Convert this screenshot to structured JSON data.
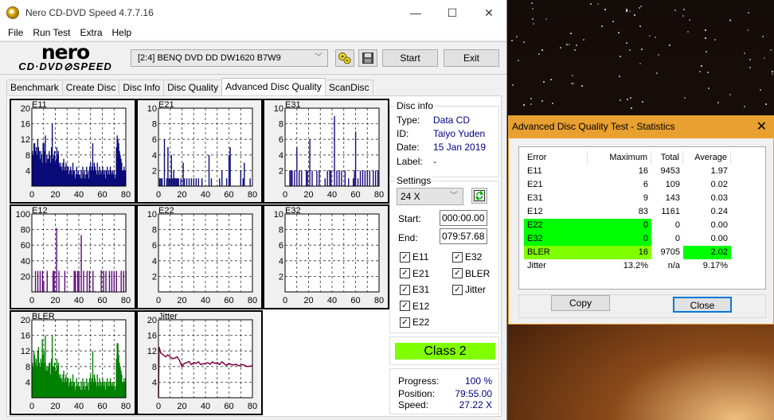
{
  "window": {
    "title": "Nero CD-DVD Speed 4.7.7.16",
    "minimize": "—",
    "maximize": "☐",
    "close": "✕"
  },
  "menu": [
    "File",
    "Run Test",
    "Extra",
    "Help"
  ],
  "logo": {
    "top": "nero",
    "bottom": "CD·DVD⊘SPEED"
  },
  "toolbar": {
    "drive": "[2:4]  BENQ DVD DD DW1620 B7W9",
    "start": "Start",
    "exit": "Exit"
  },
  "tabs": [
    "Benchmark",
    "Create Disc",
    "Disc Info",
    "Disc Quality",
    "Advanced Disc Quality",
    "ScanDisc"
  ],
  "active_tab": "Advanced Disc Quality",
  "disc_info": {
    "title": "Disc info",
    "type_label": "Type:",
    "type": "Data CD",
    "id_label": "ID:",
    "id": "Taiyo Yuden",
    "date_label": "Date:",
    "date": "15 Jan 2019",
    "label_label": "Label:",
    "label": "-"
  },
  "settings": {
    "title": "Settings",
    "speed": "24 X",
    "start_label": "Start:",
    "start": "000:00.00",
    "end_label": "End:",
    "end": "079:57.68",
    "checks": [
      {
        "label": "E11",
        "checked": true
      },
      {
        "label": "E21",
        "checked": true
      },
      {
        "label": "E31",
        "checked": true
      },
      {
        "label": "E12",
        "checked": true
      },
      {
        "label": "E22",
        "checked": true
      },
      {
        "label": "E32",
        "checked": true
      },
      {
        "label": "BLER",
        "checked": true
      },
      {
        "label": "Jitter",
        "checked": true
      }
    ]
  },
  "class": "Class 2",
  "progress": {
    "progress_label": "Progress:",
    "progress": "100 %",
    "position_label": "Position:",
    "position": "79:55.00",
    "speed_label": "Speed:",
    "speed": "27.22 X"
  },
  "stats": {
    "title": "Advanced Disc Quality Test - Statistics",
    "headers": [
      "Error",
      "Maximum",
      "Total",
      "Average"
    ],
    "rows": [
      [
        "E11",
        "16",
        "9453",
        "1.97"
      ],
      [
        "E21",
        "6",
        "109",
        "0.02"
      ],
      [
        "E31",
        "9",
        "143",
        "0.03"
      ],
      [
        "E12",
        "83",
        "1161",
        "0.24"
      ],
      [
        "E22",
        "0",
        "0",
        "0.00"
      ],
      [
        "E32",
        "0",
        "0",
        "0.00"
      ],
      [
        "BLER",
        "16",
        "9705",
        "2.02"
      ],
      [
        "Jitter",
        "13.2%",
        "n/a",
        "9.17%"
      ]
    ],
    "highlights": {
      "E22": "#00ff00",
      "E32": "#00ff00",
      "BLER": "#80ff00",
      "BLER_avg": "#00ff00"
    },
    "copy": "Copy",
    "close": "Close"
  },
  "chart_data": [
    {
      "type": "bar",
      "title": "E11",
      "ylim": [
        0,
        20
      ],
      "yticks": [
        4,
        8,
        12,
        16,
        20
      ],
      "xticks": [
        0,
        20,
        40,
        60,
        80
      ],
      "xlim": [
        0,
        80
      ],
      "color": "#0a0a78",
      "values": [
        9,
        8,
        11,
        11,
        9,
        10,
        8,
        12,
        10,
        9,
        7,
        9,
        8,
        6,
        11,
        11,
        9,
        13,
        6,
        8,
        7,
        7,
        9,
        8,
        6,
        10,
        16,
        7,
        8,
        9,
        6,
        7,
        10,
        8,
        9,
        6,
        5,
        6,
        5,
        4,
        6,
        7,
        4,
        5,
        6,
        4,
        5,
        5,
        3,
        4,
        5,
        4,
        3,
        6,
        4,
        4,
        2,
        3,
        5,
        3,
        4,
        3,
        3,
        2,
        4,
        2,
        5,
        3,
        4,
        2,
        3,
        5,
        3,
        4,
        2,
        5,
        6,
        4,
        5,
        11,
        4,
        6,
        5,
        4,
        3,
        6,
        4,
        3,
        5,
        4,
        3,
        4,
        5,
        4,
        3,
        4,
        2,
        4,
        5,
        3,
        4,
        3,
        5,
        4,
        3,
        4,
        3,
        4,
        2,
        3,
        10,
        13,
        12,
        11,
        9,
        8,
        7,
        6,
        4,
        4,
        5,
        4,
        4
      ]
    },
    {
      "type": "bar",
      "title": "E21",
      "ylim": [
        0,
        10
      ],
      "yticks": [
        2,
        4,
        6,
        8,
        10
      ],
      "xticks": [
        0,
        20,
        40,
        60,
        80
      ],
      "xlim": [
        0,
        80
      ],
      "color": "#0a0a78",
      "spikes": [
        [
          1,
          1
        ],
        [
          2,
          1
        ],
        [
          3,
          1
        ],
        [
          5,
          6
        ],
        [
          7,
          1
        ],
        [
          8,
          5
        ],
        [
          9,
          1
        ],
        [
          10,
          1
        ],
        [
          11,
          4
        ],
        [
          12,
          1
        ],
        [
          13,
          2
        ],
        [
          14,
          1
        ],
        [
          15,
          1
        ],
        [
          16,
          1
        ],
        [
          17,
          1
        ],
        [
          19,
          1
        ],
        [
          21,
          3
        ],
        [
          22,
          1
        ],
        [
          24,
          1
        ],
        [
          26,
          1
        ],
        [
          28,
          1
        ],
        [
          30,
          1
        ],
        [
          32,
          1
        ],
        [
          34,
          1
        ],
        [
          37,
          1
        ],
        [
          43,
          4
        ],
        [
          45,
          1
        ],
        [
          52,
          1
        ],
        [
          54,
          2
        ],
        [
          58,
          1
        ],
        [
          60,
          4
        ],
        [
          61,
          5
        ],
        [
          70,
          2
        ],
        [
          72,
          1
        ],
        [
          73,
          3
        ],
        [
          78,
          1
        ]
      ]
    },
    {
      "type": "bar",
      "title": "E31",
      "ylim": [
        0,
        10
      ],
      "yticks": [
        2,
        4,
        6,
        8,
        10
      ],
      "xticks": [
        0,
        20,
        40,
        60,
        80
      ],
      "xlim": [
        0,
        80
      ],
      "color": "#1a0a80",
      "spikes": [
        [
          4,
          2
        ],
        [
          5,
          2
        ],
        [
          6,
          2
        ],
        [
          8,
          2
        ],
        [
          10,
          5
        ],
        [
          12,
          2
        ],
        [
          14,
          2
        ],
        [
          18,
          2
        ],
        [
          19,
          2
        ],
        [
          21,
          6
        ],
        [
          23,
          2
        ],
        [
          27,
          2
        ],
        [
          29,
          2
        ],
        [
          34,
          1
        ],
        [
          36,
          2
        ],
        [
          38,
          2
        ],
        [
          39,
          2
        ],
        [
          42,
          9
        ],
        [
          44,
          2
        ],
        [
          46,
          2
        ],
        [
          48,
          2
        ],
        [
          51,
          2
        ],
        [
          54,
          1
        ],
        [
          58,
          1
        ],
        [
          59,
          2
        ],
        [
          60,
          7
        ],
        [
          62,
          1
        ],
        [
          64,
          2
        ],
        [
          66,
          2
        ],
        [
          68,
          2
        ],
        [
          70,
          2
        ],
        [
          72,
          2
        ],
        [
          75,
          2
        ],
        [
          77,
          2
        ],
        [
          79,
          2
        ]
      ]
    },
    {
      "type": "bar",
      "title": "E12",
      "ylim": [
        0,
        100
      ],
      "yticks": [
        20,
        40,
        60,
        80,
        100
      ],
      "xticks": [
        0,
        20,
        40,
        60,
        80
      ],
      "xlim": [
        0,
        80
      ],
      "color": "#5a0a78",
      "spikes": [
        [
          3,
          27
        ],
        [
          5,
          27
        ],
        [
          7,
          27
        ],
        [
          9,
          27
        ],
        [
          10,
          14
        ],
        [
          13,
          27
        ],
        [
          18,
          27
        ],
        [
          19,
          27
        ],
        [
          21,
          82
        ],
        [
          23,
          27
        ],
        [
          28,
          27
        ],
        [
          36,
          27
        ],
        [
          37,
          27
        ],
        [
          39,
          27
        ],
        [
          40,
          27
        ],
        [
          42,
          73
        ],
        [
          44,
          27
        ],
        [
          47,
          27
        ],
        [
          49,
          27
        ],
        [
          52,
          27
        ],
        [
          54,
          1
        ],
        [
          59,
          28
        ],
        [
          61,
          27
        ],
        [
          63,
          27
        ],
        [
          66,
          27
        ],
        [
          68,
          27
        ],
        [
          70,
          27
        ],
        [
          72,
          27
        ],
        [
          76,
          27
        ],
        [
          78,
          27
        ],
        [
          80,
          27
        ]
      ]
    },
    {
      "type": "bar",
      "title": "E22",
      "ylim": [
        0,
        10
      ],
      "yticks": [
        2,
        4,
        6,
        8,
        10
      ],
      "xticks": [
        0,
        20,
        40,
        60,
        80
      ],
      "xlim": [
        0,
        80
      ],
      "color": "#0a0a78",
      "spikes": []
    },
    {
      "type": "bar",
      "title": "E32",
      "ylim": [
        0,
        10
      ],
      "yticks": [
        2,
        4,
        6,
        8,
        10
      ],
      "xticks": [
        0,
        20,
        40,
        60,
        80
      ],
      "xlim": [
        0,
        80
      ],
      "color": "#0a0a78",
      "spikes": []
    },
    {
      "type": "bar",
      "title": "BLER",
      "ylim": [
        0,
        20
      ],
      "yticks": [
        4,
        8,
        12,
        16,
        20
      ],
      "xticks": [
        0,
        20,
        40,
        60,
        80
      ],
      "xlim": [
        0,
        80
      ],
      "color": "#008000",
      "values": [
        9,
        8,
        12,
        11,
        9,
        10,
        8,
        12,
        13,
        9,
        8,
        10,
        9,
        15,
        11,
        12,
        9,
        16,
        7,
        8,
        7,
        8,
        9,
        9,
        6,
        10,
        16,
        8,
        8,
        9,
        7,
        7,
        10,
        8,
        9,
        6,
        5,
        6,
        5,
        4,
        6,
        7,
        4,
        5,
        6,
        4,
        5,
        5,
        3,
        4,
        5,
        4,
        3,
        6,
        4,
        4,
        2,
        3,
        5,
        3,
        4,
        3,
        3,
        2,
        4,
        2,
        5,
        3,
        4,
        2,
        3,
        5,
        3,
        4,
        2,
        5,
        6,
        4,
        5,
        12,
        4,
        6,
        5,
        4,
        3,
        6,
        4,
        3,
        5,
        4,
        3,
        4,
        5,
        4,
        3,
        4,
        2,
        4,
        5,
        3,
        4,
        3,
        5,
        4,
        3,
        4,
        3,
        4,
        2,
        3,
        10,
        14,
        14,
        11,
        9,
        8,
        7,
        6,
        4,
        4,
        5,
        4,
        5
      ]
    },
    {
      "type": "line",
      "title": "Jitter",
      "ylim": [
        0,
        20
      ],
      "yticks": [
        4,
        8,
        12,
        16,
        20
      ],
      "xticks": [
        0,
        20,
        40,
        60,
        80
      ],
      "xlim": [
        0,
        80
      ],
      "color": "#800040",
      "x": [
        0,
        0.5,
        2,
        4,
        6,
        8,
        10,
        12,
        14,
        16,
        18,
        20,
        22,
        24,
        26,
        28,
        30,
        32,
        34,
        36,
        38,
        40,
        42,
        44,
        46,
        48,
        50,
        52,
        54,
        56,
        58,
        60,
        62,
        64,
        66,
        68,
        70,
        72,
        74,
        76,
        78,
        80
      ],
      "values": [
        0,
        13,
        11.5,
        11,
        10.5,
        11,
        10.5,
        10,
        10.2,
        10.5,
        9.5,
        8,
        8.8,
        9,
        9.3,
        8.5,
        9,
        8.8,
        9.2,
        8.5,
        8.7,
        8.8,
        9,
        8.6,
        9.2,
        8.8,
        9,
        8.5,
        9.2,
        8.7,
        8.3,
        8.8,
        8.5,
        8.4,
        8.6,
        8.2,
        8.4,
        8.5,
        8.2,
        8,
        8.1,
        8.2
      ]
    }
  ]
}
